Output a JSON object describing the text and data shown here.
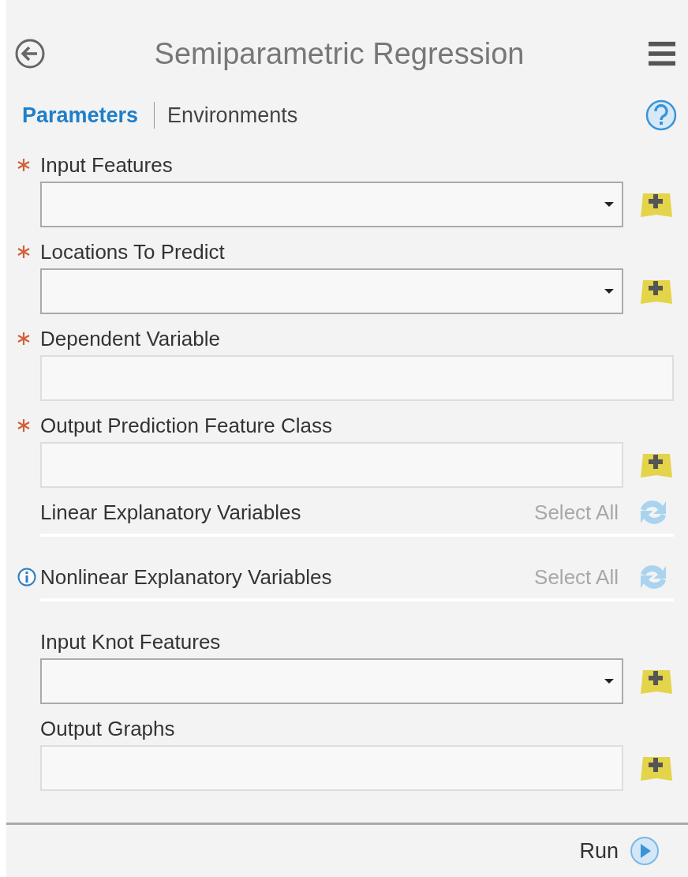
{
  "header": {
    "title": "Semiparametric Regression"
  },
  "tabs": [
    {
      "label": "Parameters",
      "selected": true
    },
    {
      "label": "Environments",
      "selected": false
    }
  ],
  "parameters": [
    {
      "kind": "dropdown",
      "label": "Input Features",
      "required": true
    },
    {
      "kind": "dropdown",
      "label": "Locations To Predict",
      "required": true
    },
    {
      "kind": "text",
      "label": "Dependent Variable",
      "required": true
    },
    {
      "kind": "output",
      "label": "Output Prediction Feature Class",
      "required": true
    },
    {
      "kind": "multi",
      "label": "Linear Explanatory Variables",
      "required": false,
      "info": false,
      "select_all": {
        "label": "Select All",
        "disabled": true
      }
    },
    {
      "kind": "multi",
      "label": "Nonlinear Explanatory Variables",
      "required": false,
      "info": true,
      "select_all": {
        "label": "Select All",
        "disabled": true
      }
    },
    {
      "kind": "dropdown",
      "label": "Input Knot Features",
      "required": false
    },
    {
      "kind": "output",
      "label": "Output Graphs",
      "required": false
    }
  ],
  "footer": {
    "run_label": "Run"
  }
}
